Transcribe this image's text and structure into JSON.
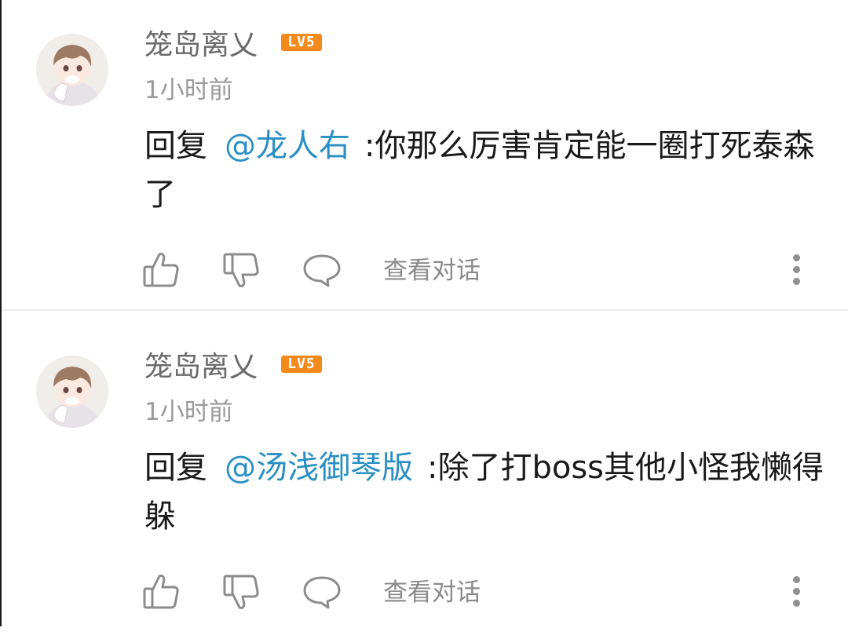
{
  "comments": [
    {
      "username": "笼岛离乂",
      "level": "LV5",
      "time": "1小时前",
      "reply_prefix": "回复",
      "mention": "@龙人右",
      "separator": ":",
      "text": "你那么厉害肯定能一圈打死泰森了",
      "view_conversation": "查看对话",
      "icons": [
        "avatar-image",
        "like-icon",
        "dislike-icon",
        "comment-icon",
        "more-vertical-icon"
      ]
    },
    {
      "username": "笼岛离乂",
      "level": "LV5",
      "time": "1小时前",
      "reply_prefix": "回复",
      "mention": "@汤浅御琴版",
      "separator": ":",
      "text": "除了打boss其他小怪我懒得躲",
      "view_conversation": "查看对话",
      "icons": [
        "avatar-image",
        "like-icon",
        "dislike-icon",
        "comment-icon",
        "more-vertical-icon"
      ]
    }
  ],
  "colors": {
    "mention": "#2a8fc4",
    "level_badge": "#f38a1b",
    "meta_text": "#9a9a9a"
  }
}
